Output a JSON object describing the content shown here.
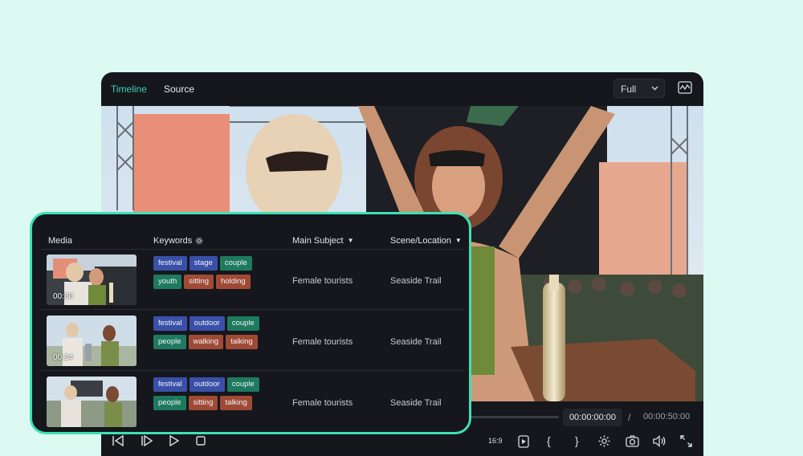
{
  "header": {
    "tabs": [
      {
        "label": "Timeline",
        "active": true
      },
      {
        "label": "Source",
        "active": false
      }
    ],
    "view_select": "Full",
    "accent": "#3fd0b0"
  },
  "controls": {
    "current_time": "00:00:00:00",
    "separator": "/",
    "total_time": "00:00:50:00",
    "aspect_label": "16:9",
    "bracket_in": "{",
    "bracket_out": "}"
  },
  "table": {
    "columns": [
      {
        "label": "Media"
      },
      {
        "label": "Keywords"
      },
      {
        "label": "Main Subject"
      },
      {
        "label": "Scene/Location"
      }
    ],
    "rows": [
      {
        "duration": "00:30",
        "tags": [
          {
            "label": "festival",
            "color": "#3a50a8"
          },
          {
            "label": "stage",
            "color": "#3a50a8"
          },
          {
            "label": "couple",
            "color": "#1e7a5e"
          },
          {
            "label": "youth",
            "color": "#1e7a5e"
          },
          {
            "label": "sitting",
            "color": "#a04a35"
          },
          {
            "label": "holding",
            "color": "#a04a35"
          }
        ],
        "main_subject": "Female tourists",
        "scene": "Seaside Trail"
      },
      {
        "duration": "00:24",
        "tags": [
          {
            "label": "festival",
            "color": "#3a50a8"
          },
          {
            "label": "outdoor",
            "color": "#3a50a8"
          },
          {
            "label": "couple",
            "color": "#1e7a5e"
          },
          {
            "label": "people",
            "color": "#1e7a5e"
          },
          {
            "label": "walking",
            "color": "#a04a35"
          },
          {
            "label": "talking",
            "color": "#a04a35"
          }
        ],
        "main_subject": "Female tourists",
        "scene": "Seaside Trail"
      },
      {
        "duration": "",
        "tags": [
          {
            "label": "festival",
            "color": "#3a50a8"
          },
          {
            "label": "outdoor",
            "color": "#3a50a8"
          },
          {
            "label": "couple",
            "color": "#1e7a5e"
          },
          {
            "label": "people",
            "color": "#1e7a5e"
          },
          {
            "label": "sitting",
            "color": "#a04a35"
          },
          {
            "label": "talking",
            "color": "#a04a35"
          }
        ],
        "main_subject": "Female tourists",
        "scene": "Seaside Trail"
      }
    ]
  }
}
